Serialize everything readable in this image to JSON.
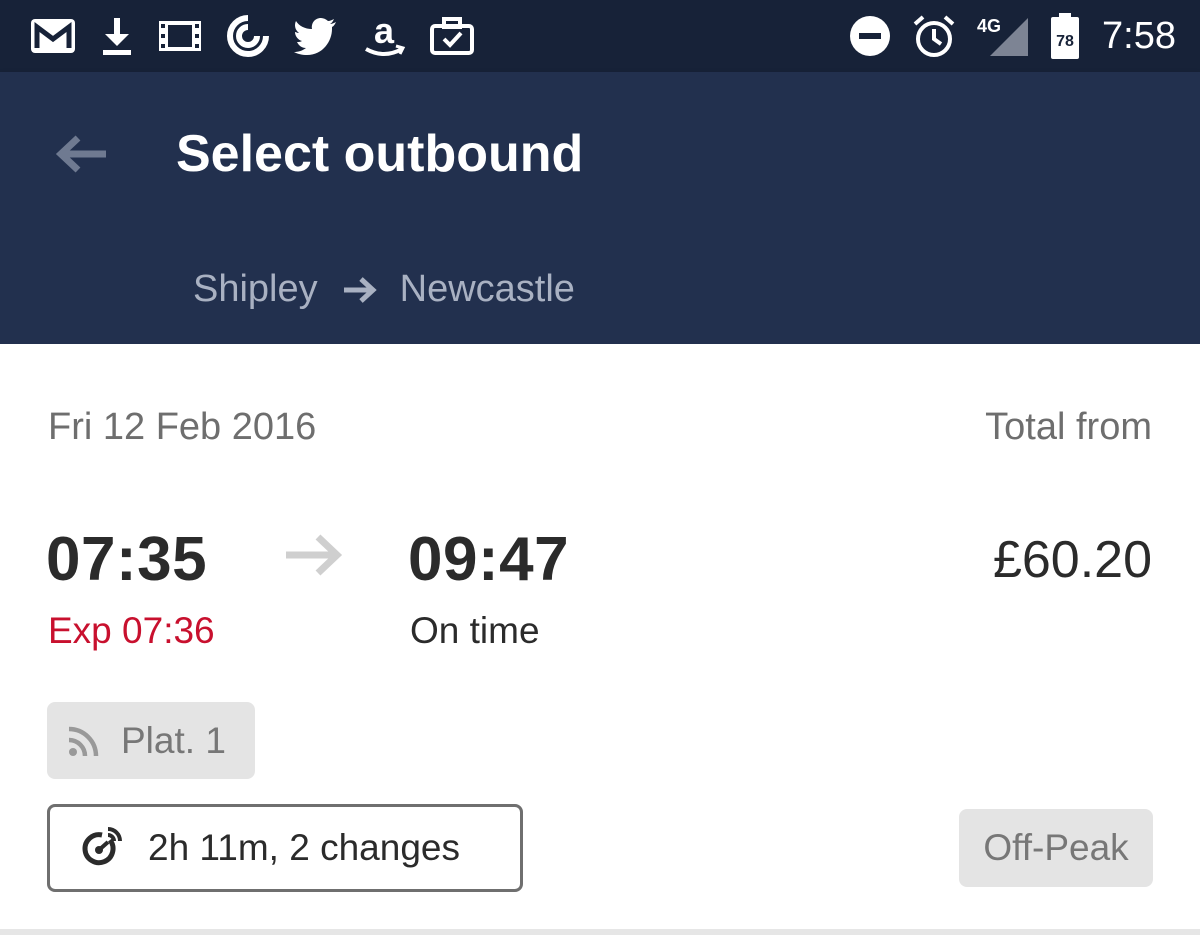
{
  "status_bar": {
    "left_icons": [
      "gmail-icon",
      "download-icon",
      "film-icon",
      "pocket-casts-icon",
      "twitter-icon",
      "amazon-icon",
      "briefcase-check-icon"
    ],
    "right_icons": [
      "do-not-disturb-icon",
      "alarm-icon",
      "signal-4g-icon",
      "battery-icon"
    ],
    "network_label": "4G",
    "battery_level": "78",
    "time": "7:58"
  },
  "header": {
    "title": "Select outbound",
    "back_icon": "back-arrow-icon",
    "route": {
      "origin": "Shipley",
      "destination": "Newcastle",
      "arrow_icon": "arrow-right-icon"
    }
  },
  "journey": {
    "date": "Fri 12 Feb 2016",
    "total_label": "Total from",
    "departure_time": "07:35",
    "departure_status": "Exp 07:36",
    "arrival_time": "09:47",
    "arrival_status": "On time",
    "price": "£60.20",
    "platform": "Plat. 1",
    "platform_icon": "realtime-signal-icon",
    "duration": "2h 11m, 2 changes",
    "duration_icon": "clock-live-icon",
    "fare_type": "Off-Peak"
  },
  "colors": {
    "status_bar_bg": "#172238",
    "app_bar_bg": "#22304e",
    "late_status": "#c8102e",
    "badge_bg": "#e4e4e4"
  }
}
